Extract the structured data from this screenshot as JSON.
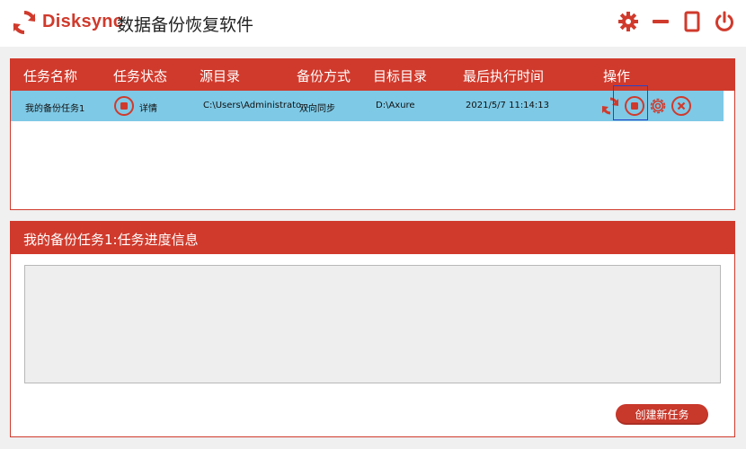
{
  "app": {
    "brand": "Disksync",
    "title": "数据备份恢复软件",
    "accent_color": "#d03a2c",
    "logo_icon": "refresh-logo-icon"
  },
  "window_controls": {
    "settings_icon": "gear-icon",
    "minimize_icon": "minimize-icon",
    "maximize_icon": "maximize-icon",
    "close_icon": "power-icon"
  },
  "task_table": {
    "columns": [
      "任务名称",
      "任务状态",
      "源目录",
      "备份方式",
      "目标目录",
      "最后执行时间",
      "操作"
    ],
    "rows": [
      {
        "name": "我的备份任务1",
        "status": "详情",
        "source": "C:\\Users\\Administrato...",
        "method": "双向同步",
        "target": "D:\\Axure",
        "last_run": "2021/5/7 11:14:13",
        "selected_color": "#7ec9e6"
      }
    ],
    "operations": [
      "sync-icon",
      "stop-icon",
      "gear-icon",
      "close-circle-icon"
    ]
  },
  "progress": {
    "title": "我的备份任务1:任务进度信息",
    "log_text": ""
  },
  "create_button": "创建新任务"
}
